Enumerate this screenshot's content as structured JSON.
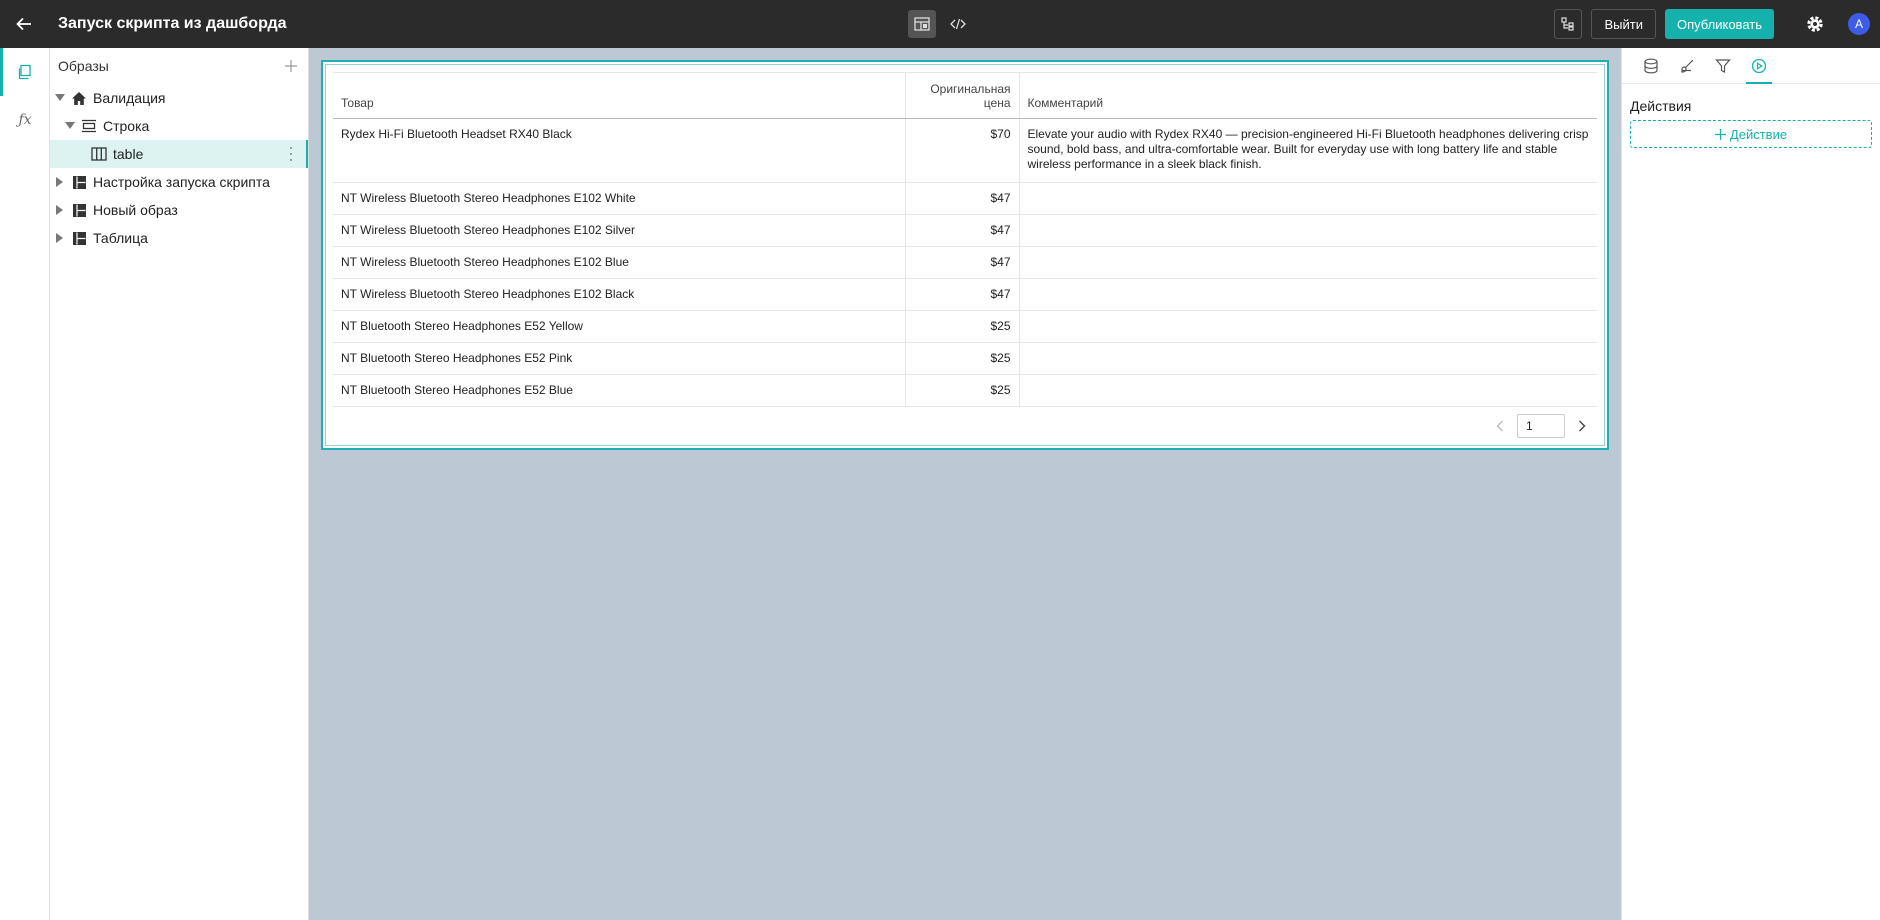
{
  "header": {
    "title": "Запуск скрипта из дашборда",
    "exit_label": "Выйти",
    "publish_label": "Опубликовать",
    "avatar_initial": "A",
    "accent": "#15b2ad"
  },
  "tree": {
    "title": "Образы",
    "nodes": [
      {
        "label": "Валидация",
        "icon": "home-icon",
        "expanded": true
      },
      {
        "label": "Строка",
        "icon": "row-icon",
        "expanded": true
      },
      {
        "label": "table",
        "icon": "table-columns-icon",
        "selected": true
      },
      {
        "label": "Настройка запуска скрипта",
        "icon": "dashboard-icon",
        "expanded": false
      },
      {
        "label": "Новый образ",
        "icon": "dashboard-icon",
        "expanded": false
      },
      {
        "label": "Таблица",
        "icon": "dashboard-icon",
        "expanded": false
      }
    ]
  },
  "table": {
    "headers": {
      "product": "Товар",
      "price_line1": "Оригинальная",
      "price_line2": "цена",
      "comment": "Комментарий"
    },
    "rows": [
      {
        "product": "Rydex Hi-Fi Bluetooth Headset RX40 Black",
        "price": "$70",
        "comment": "Elevate your audio with Rydex RX40 — precision-engineered Hi-Fi Bluetooth headphones delivering crisp sound, bold bass, and ultra-comfortable wear. Built for everyday use with long battery life and stable wireless performance in a sleek black finish."
      },
      {
        "product": "NT Wireless Bluetooth Stereo Headphones E102 White",
        "price": "$47",
        "comment": ""
      },
      {
        "product": "NT Wireless Bluetooth Stereo Headphones E102 Silver",
        "price": "$47",
        "comment": ""
      },
      {
        "product": "NT Wireless Bluetooth Stereo Headphones E102 Blue",
        "price": "$47",
        "comment": ""
      },
      {
        "product": "NT Wireless Bluetooth Stereo Headphones E102 Black",
        "price": "$47",
        "comment": ""
      },
      {
        "product": "NT Bluetooth Stereo Headphones E52 Yellow",
        "price": "$25",
        "comment": ""
      },
      {
        "product": "NT Bluetooth Stereo Headphones E52 Pink",
        "price": "$25",
        "comment": ""
      },
      {
        "product": "NT Bluetooth Stereo Headphones E52 Blue",
        "price": "$25",
        "comment": ""
      }
    ],
    "page": "1"
  },
  "right_panel": {
    "title": "Действия",
    "add_action_label": "Действие",
    "tabs": [
      "database-icon",
      "brush-icon",
      "filter-icon",
      "play-circle-icon"
    ],
    "active_tab": "play-circle-icon"
  }
}
